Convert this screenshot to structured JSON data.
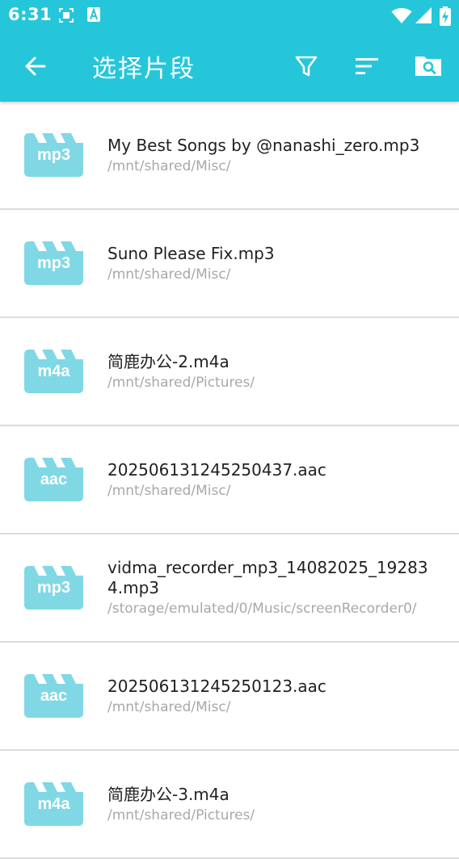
{
  "status_bar": {
    "time": "6:31",
    "icons": [
      "screenshot-icon",
      "keyboard-a-icon",
      "wifi-icon",
      "signal-icon",
      "battery-charging-icon"
    ]
  },
  "app_bar": {
    "title": "选择片段",
    "icons": [
      "back-arrow-icon",
      "filter-icon",
      "sort-icon",
      "folder-search-icon"
    ]
  },
  "colors": {
    "accent": "#26c6da",
    "file_icon": "#80d8e5",
    "text_primary": "#212121",
    "text_secondary": "#a8a8a8",
    "divider": "#dcdcdc"
  },
  "files": [
    {
      "ext": "mp3",
      "name": "My Best Songs by @nanashi_zero.mp3",
      "path": "/mnt/shared/Misc/"
    },
    {
      "ext": "mp3",
      "name": "Suno Please Fix.mp3",
      "path": "/mnt/shared/Misc/"
    },
    {
      "ext": "m4a",
      "name": "简鹿办公-2.m4a",
      "path": "/mnt/shared/Pictures/"
    },
    {
      "ext": "aac",
      "name": "20250613124525043​7.aac",
      "path": "/mnt/shared/Misc/"
    },
    {
      "ext": "mp3",
      "name": "vidma_recorder_mp3_14082025_192834.mp3",
      "path": "/storage/emulated/0/Music/screenRecorder0/"
    },
    {
      "ext": "aac",
      "name": "202506131245250123.aac",
      "path": "/mnt/shared/Misc/"
    },
    {
      "ext": "m4a",
      "name": "简鹿办公-3.m4a",
      "path": "/mnt/shared/Pictures/"
    }
  ]
}
